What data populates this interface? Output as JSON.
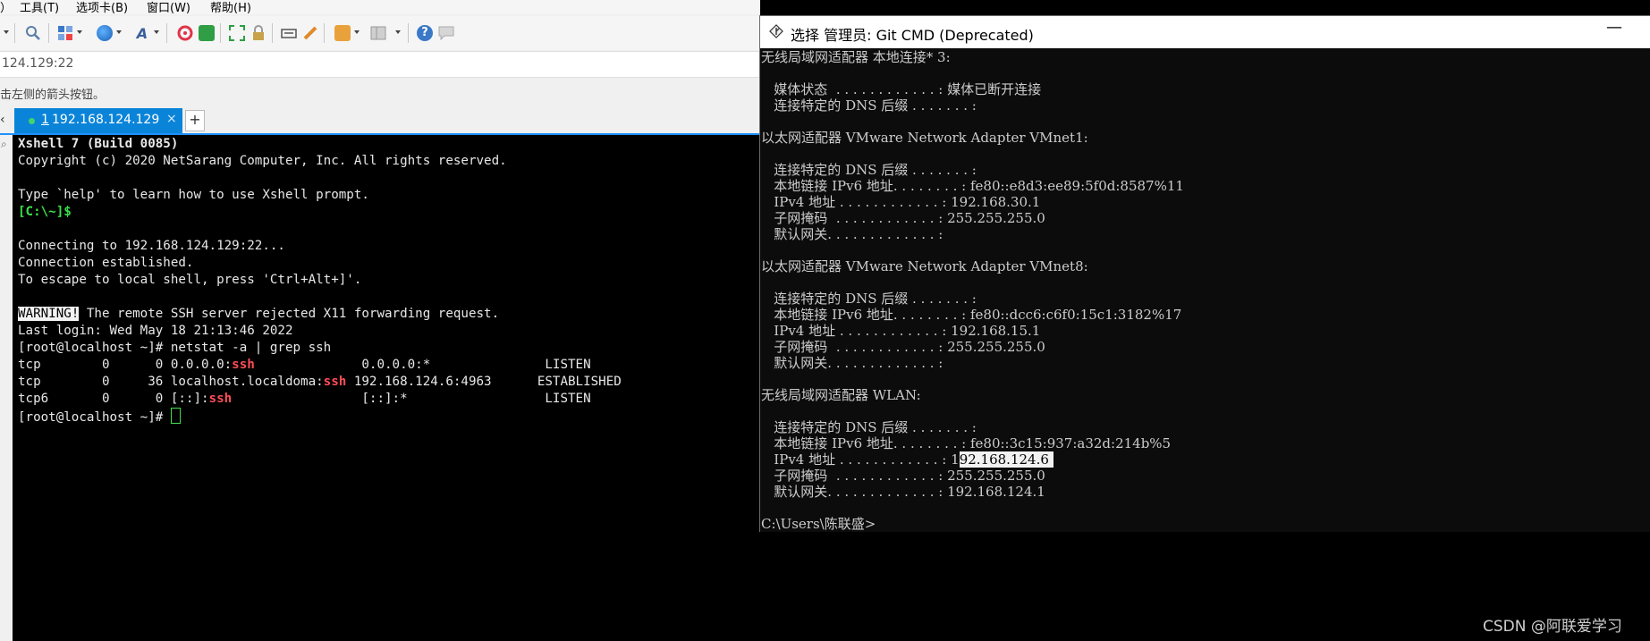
{
  "xshell": {
    "menu": [
      "）",
      "工具(T)",
      "选项卡(B)",
      "窗口(W)",
      "帮助(H)"
    ],
    "toolbar_icons": [
      "dropdown-caret-icon",
      "search-icon",
      "new-session-icon",
      "globe-icon",
      "font-icon",
      "xftp-icon",
      "transfer-icon",
      "fullscreen-icon",
      "lock-icon",
      "keyboard-icon",
      "highlight-icon",
      "compose-icon",
      "layout-icon",
      "help-icon",
      "chat-icon"
    ],
    "address": "124.129:22",
    "hint": "击左侧的箭头按钮。",
    "tab": {
      "number": "1",
      "title": "192.168.124.129",
      "close": "×",
      "add": "+"
    },
    "left_arrow": "‹",
    "terminal": {
      "line1": "Xshell 7 (Build 0085)",
      "line2": "Copyright (c) 2020 NetSarang Computer, Inc. All rights reserved.",
      "line4": "Type `help' to learn how to use Xshell prompt.",
      "prompt_local": "[C:\\~]$",
      "line7": "Connecting to 192.168.124.129:22...",
      "line8": "Connection established.",
      "line9": "To escape to local shell, press 'Ctrl+Alt+]'.",
      "warning_tag": "WARNING!",
      "warning_rest": " The remote SSH server rejected X11 forwarding request.",
      "last_login": "Last login: Wed May 18 21:13:46 2022",
      "cmd_line": "[root@localhost ~]# netstat -a | grep ssh",
      "rows": [
        {
          "pre": "tcp        0      0 0.0.0.0:",
          "hl": "ssh",
          "post": "              0.0.0.0:*               LISTEN"
        },
        {
          "pre": "tcp        0     36 localhost.localdoma:",
          "hl": "ssh",
          "post": " 192.168.124.6:4963      ESTABLISHED"
        },
        {
          "pre": "tcp6       0      0 [::]:",
          "hl": "ssh",
          "post": "                 [::]:*                  LISTEN"
        }
      ],
      "final_prompt": "[root@localhost ~]# "
    }
  },
  "cmd": {
    "title": "选择 管理员: Git CMD (Deprecated)",
    "minimize": "—",
    "lines": [
      "无线局域网适配器 本地连接* 3:",
      "",
      "   媒体状态  . . . . . . . . . . . . : 媒体已断开连接",
      "   连接特定的 DNS 后缀 . . . . . . . :",
      "",
      "以太网适配器 VMware Network Adapter VMnet1:",
      "",
      "   连接特定的 DNS 后缀 . . . . . . . :",
      "   本地链接 IPv6 地址. . . . . . . . : fe80::e8d3:ee89:5f0d:8587%11",
      "   IPv4 地址 . . . . . . . . . . . . : 192.168.30.1",
      "   子网掩码  . . . . . . . . . . . . : 255.255.255.0",
      "   默认网关. . . . . . . . . . . . . :",
      "",
      "以太网适配器 VMware Network Adapter VMnet8:",
      "",
      "   连接特定的 DNS 后缀 . . . . . . . :",
      "   本地链接 IPv6 地址. . . . . . . . : fe80::dcc6:c6f0:15c1:3182%17",
      "   IPv4 地址 . . . . . . . . . . . . : 192.168.15.1",
      "   子网掩码  . . . . . . . . . . . . : 255.255.255.0",
      "   默认网关. . . . . . . . . . . . . :",
      "",
      "无线局域网适配器 WLAN:",
      "",
      "   连接特定的 DNS 后缀 . . . . . . . :",
      "   本地链接 IPv6 地址. . . . . . . . : fe80::3c15:937:a32d:214b%5",
      "   IPv4 地址 . . . . . . . . . . . . : 1",
      "   子网掩码  . . . . . . . . . . . . : 255.255.255.0",
      "   默认网关. . . . . . . . . . . . . : 192.168.124.1",
      "",
      "C:\\Users\\陈联盛>"
    ],
    "selected_text": "92.168.124.6 "
  },
  "watermark": "CSDN @阿联爱学习"
}
